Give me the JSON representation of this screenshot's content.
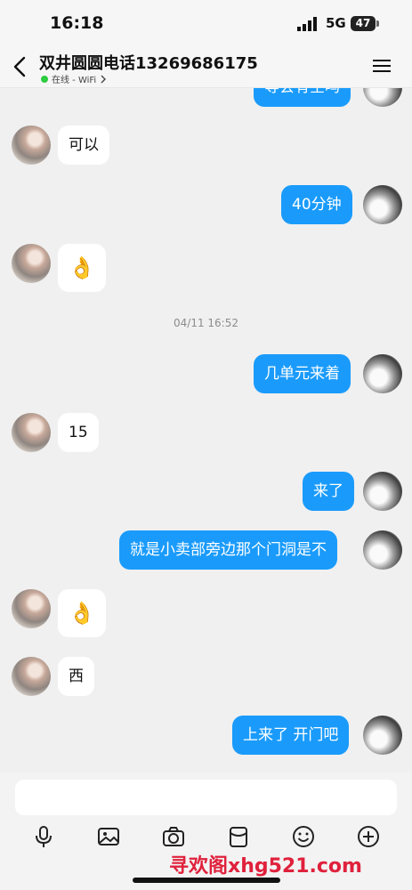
{
  "status_bar": {
    "time": "16:18",
    "network": "5G",
    "battery": "47"
  },
  "header": {
    "title": "双井圆圆电话13269686175",
    "online_status": "在线 - WiFi"
  },
  "chat": {
    "partial_top_message": "等会有空吗",
    "timestamp": "04/11 16:52",
    "messages": [
      {
        "side": "in",
        "text": "可以"
      },
      {
        "side": "out",
        "text": "40分钟"
      },
      {
        "side": "in",
        "text": "👌"
      },
      {
        "side": "out",
        "text": "几单元来着"
      },
      {
        "side": "in",
        "text": "15"
      },
      {
        "side": "out",
        "text": "来了"
      },
      {
        "side": "out",
        "text": "就是小卖部旁边那个门洞是不"
      },
      {
        "side": "in",
        "text": "👌"
      },
      {
        "side": "in",
        "text": "西"
      },
      {
        "side": "out",
        "text": "上来了 开门吧"
      }
    ]
  },
  "toolbar": {
    "icons": [
      "microphone-icon",
      "image-icon",
      "camera-icon",
      "red-packet-icon",
      "emoji-icon",
      "plus-icon"
    ]
  },
  "watermark": "寻欢阁xhg521.com"
}
